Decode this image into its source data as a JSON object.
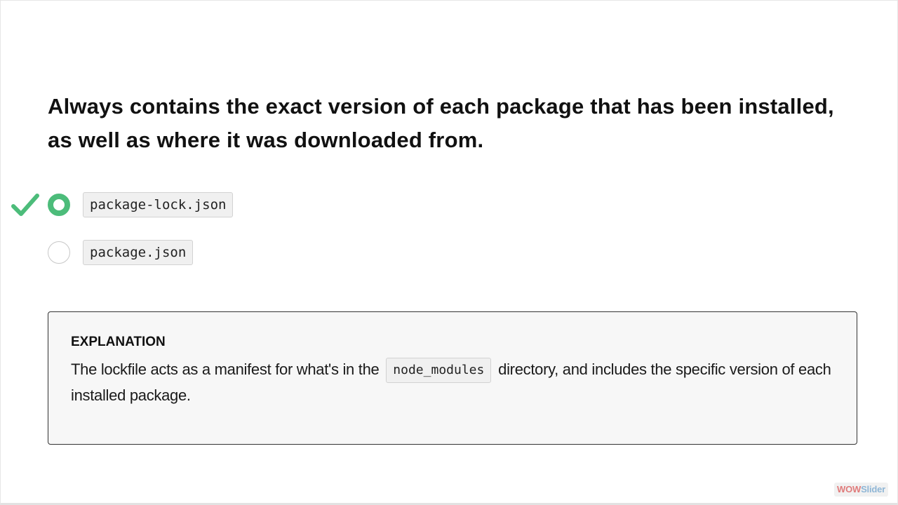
{
  "question": {
    "text": "Always contains the exact version of each package that has been installed, as well as where it was downloaded from."
  },
  "options": [
    {
      "label": "package-lock.json",
      "selected": true,
      "correct": true,
      "status_icon": "check-icon"
    },
    {
      "label": "package.json",
      "selected": false,
      "correct": false
    }
  ],
  "explanation": {
    "heading": "EXPLANATION",
    "text_before": "The lockfile acts as a manifest for what's in the",
    "code": "node_modules",
    "text_after": "directory, and includes the specific version of each installed package."
  },
  "watermark": {
    "part1": "WOW",
    "part2": "Slider"
  },
  "colors": {
    "accent_green": "#4cbc7a",
    "chip_background": "#f0f0f0",
    "panel_background": "#f7f7f7",
    "panel_border": "#333333"
  }
}
